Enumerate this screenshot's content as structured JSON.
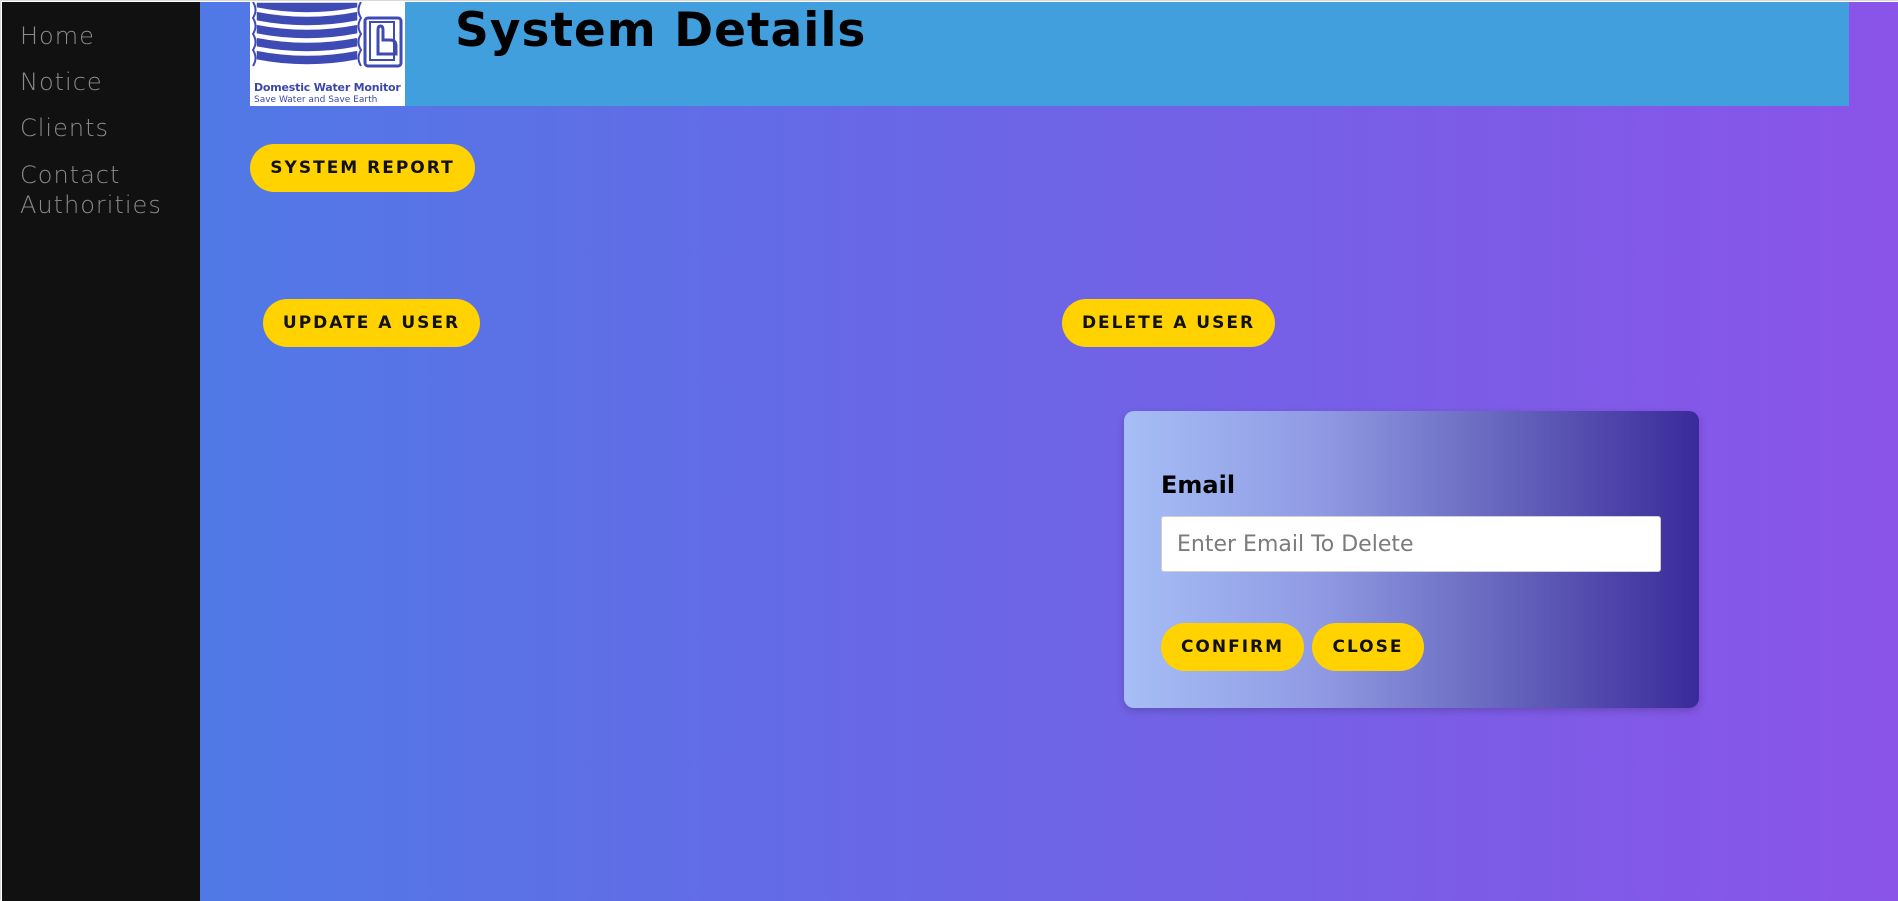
{
  "sidebar": {
    "items": [
      {
        "label": "Home"
      },
      {
        "label": "Notice"
      },
      {
        "label": "Clients"
      },
      {
        "label": "Contact"
      },
      {
        "label": "Authorities"
      }
    ]
  },
  "header": {
    "logo_title": "Domestic Water Monitor",
    "logo_subtitle": "Save Water and Save Earth",
    "page_title": "System Details"
  },
  "buttons": {
    "system_report": "SYSTEM REPORT",
    "update_user": "UPDATE A USER",
    "delete_user": "DELETE A USER"
  },
  "delete_modal": {
    "email_label": "Email",
    "email_value": "",
    "email_placeholder": "Enter Email To Delete",
    "confirm": "CONFIRM",
    "close": "CLOSE"
  },
  "colors": {
    "sidebar_bg": "#111111",
    "header_bg": "#419fdd",
    "button_bg": "#ffd200",
    "gradient_start": "#5079e6",
    "gradient_end": "#8a54e8"
  },
  "icons": {
    "logo": "water-tank-tap-icon"
  }
}
